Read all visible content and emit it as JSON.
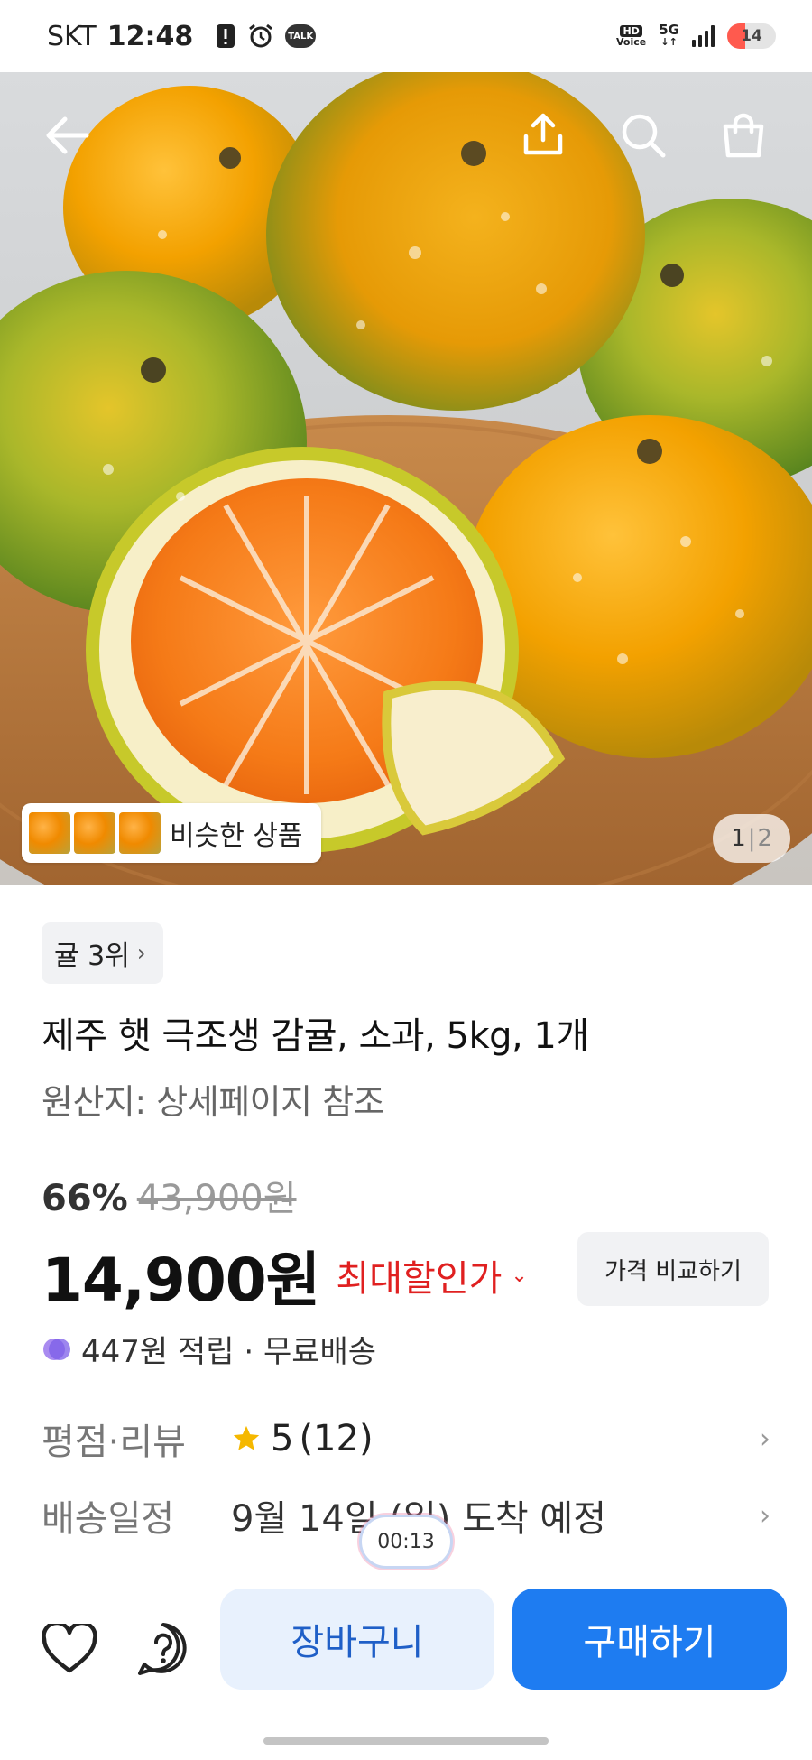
{
  "status_bar": {
    "carrier": "SKT",
    "time": "12:48",
    "talk_label": "TALK",
    "hd_label": "HD",
    "voice_label": "Voice",
    "network_label": "5G",
    "battery_level": "14"
  },
  "hero": {
    "similar_products_label": "비슷한 상품",
    "pager_current": "1",
    "pager_total": "2"
  },
  "product": {
    "rank_label": "귤 3위",
    "title": "제주 햇 극조생 감귤, 소과, 5kg, 1개",
    "origin": "원산지: 상세페이지 참조",
    "discount_percent": "66%",
    "original_price": "43,900원",
    "price": "14,900원",
    "max_discount_label": "최대할인가",
    "compare_button_label": "가격 비교하기",
    "points_and_shipping": "447원 적립 · 무료배송"
  },
  "rating": {
    "label": "평점·리뷰",
    "score": "5",
    "count": "(12)"
  },
  "delivery": {
    "label": "배송일정",
    "value": "9월 14일 (일) 도착 예정"
  },
  "overlay": {
    "timer": "00:13"
  },
  "bottom_bar": {
    "cart_label": "장바구니",
    "buy_label": "구매하기"
  },
  "colors": {
    "accent_blue": "#1e7cf1",
    "cart_bg": "#e8f1fd",
    "sale_red": "#e02020",
    "star_yellow": "#f5b800"
  }
}
